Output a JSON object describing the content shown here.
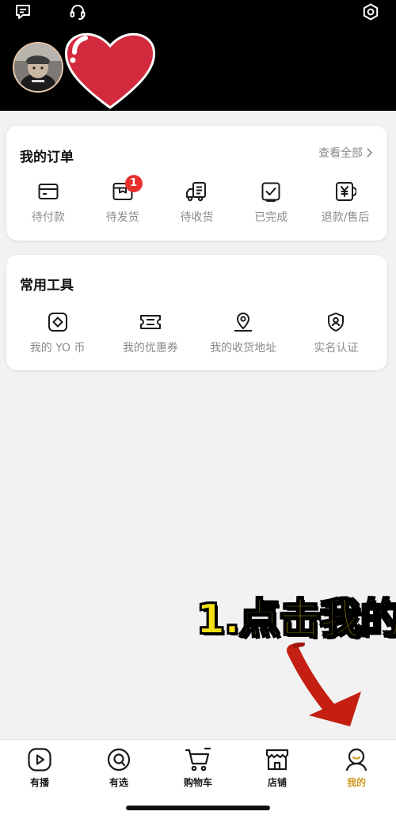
{
  "orders": {
    "title": "我的订单",
    "view_all": "查看全部",
    "items": [
      {
        "label": "待付款",
        "icon": "wallet-icon"
      },
      {
        "label": "待发货",
        "icon": "box-icon",
        "badge": "1"
      },
      {
        "label": "待收货",
        "icon": "truck-icon"
      },
      {
        "label": "已完成",
        "icon": "check-icon"
      },
      {
        "label": "退款/售后",
        "icon": "refund-icon"
      }
    ]
  },
  "tools": {
    "title": "常用工具",
    "items": [
      {
        "label": "我的 YO 币",
        "icon": "coin-icon"
      },
      {
        "label": "我的优惠券",
        "icon": "coupon-icon"
      },
      {
        "label": "我的收货地址",
        "icon": "location-icon"
      },
      {
        "label": "实名认证",
        "icon": "id-shield-icon"
      }
    ]
  },
  "annotation": {
    "text": "1.点击我的",
    "color": "#f4e017"
  },
  "tabbar": {
    "items": [
      {
        "label": "有播",
        "icon": "play-icon"
      },
      {
        "label": "有选",
        "icon": "search-q-icon"
      },
      {
        "label": "购物车",
        "icon": "cart-icon"
      },
      {
        "label": "店铺",
        "icon": "store-icon"
      },
      {
        "label": "我的",
        "icon": "profile-icon",
        "active": true
      }
    ],
    "active_color": "#d19a24"
  },
  "colors": {
    "badge": "#e8312f",
    "header": "#000000",
    "heart": "#d42a3e"
  }
}
